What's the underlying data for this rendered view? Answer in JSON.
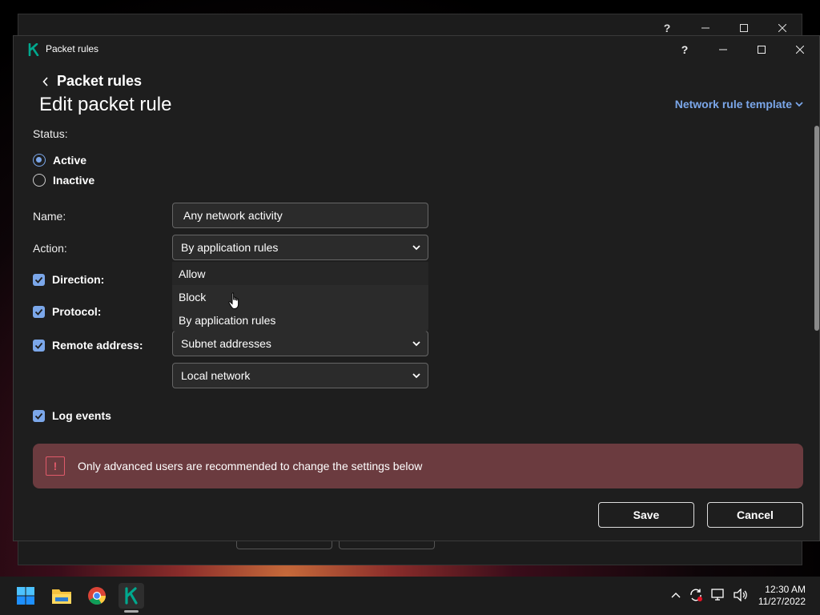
{
  "app": {
    "title": "Packet rules",
    "help_glyph": "?"
  },
  "header": {
    "breadcrumb": "Packet rules",
    "page_title": "Edit packet rule",
    "template_link": "Network rule template"
  },
  "status": {
    "label": "Status:",
    "options": [
      "Active",
      "Inactive"
    ],
    "selected": "Active"
  },
  "fields": {
    "name_label": "Name:",
    "name_value": "Any network activity",
    "action_label": "Action:",
    "action_value": "By application rules",
    "action_options": [
      "Allow",
      "Block",
      "By application rules"
    ],
    "direction_label": "Direction:",
    "protocol_label": "Protocol:",
    "remote_address_label": "Remote address:",
    "remote_address_value": "Subnet addresses",
    "remote_address_sub_value": "Local network",
    "log_events_label": "Log events"
  },
  "warning": {
    "text": "Only advanced users are recommended to change the settings below",
    "icon_glyph": "!"
  },
  "buttons": {
    "save": "Save",
    "cancel": "Cancel"
  },
  "colors": {
    "accent": "#7ba7ea",
    "warning_bg": "#6b3b3f",
    "dialog_bg": "#1e1e1e"
  },
  "taskbar": {
    "apps": [
      "start-icon",
      "file-explorer-icon",
      "chrome-icon",
      "kaspersky-icon"
    ],
    "time": "12:30 AM",
    "date": "11/27/2022"
  }
}
